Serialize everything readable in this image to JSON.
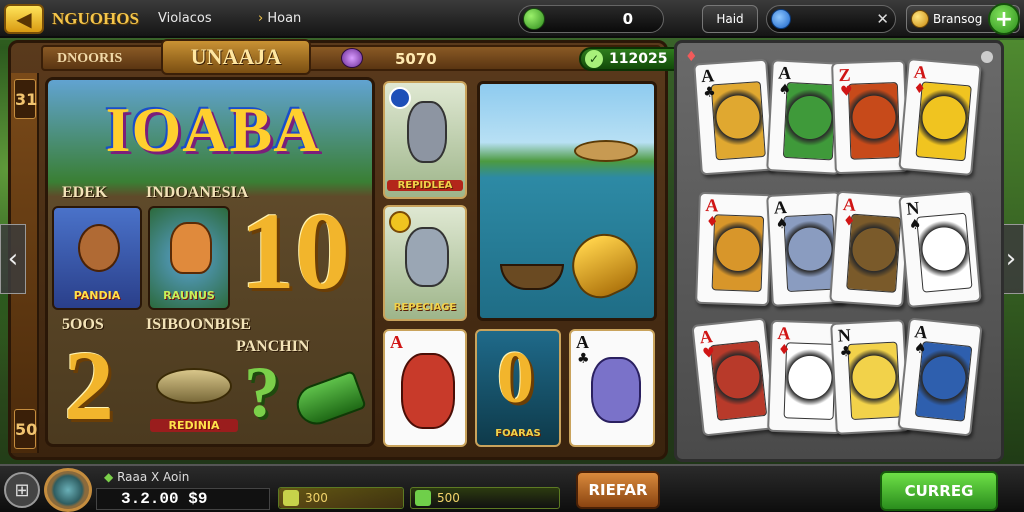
{
  "topbar": {
    "back_glyph": "◀",
    "title": "NGUOHOS",
    "tab_one": "Violacos",
    "tab_two": "Hoan",
    "gems_value": "0",
    "hold_label": "Haid",
    "coins_label": "Bransog"
  },
  "header": {
    "left_label": "DNOORIS",
    "center_title": "UNAAJA",
    "center_value": "5070",
    "score_value": "112025"
  },
  "rails": {
    "top_number": "31",
    "bottom_number": "50"
  },
  "slot": {
    "logo_text": "IOABA",
    "label_top_left": "EDEK",
    "label_top_right": "INDOANESIA",
    "label_mid_left": "5OOS",
    "label_mid_right": "ISIBOONBISE",
    "label_mid_far": "PANCHIN",
    "tile_mouse_caption": "PANDIA",
    "tile_fox_caption": "RAUNUS",
    "tile_fish_caption": "REDINIA",
    "big_digits_one": "10",
    "big_digit_two": "2",
    "big_digit_three": "?"
  },
  "middle": {
    "tile_donkey_caption": "REPIDLEA",
    "tile_shark_caption": "REPECIAGE",
    "tile_fox_card_rank": "A",
    "tile_zero_caption": "FOARAS",
    "tile_zero_digit": "0",
    "tile_ace_rank": "A"
  },
  "cards": [
    {
      "rank": "A",
      "suit": "♣",
      "color": "black",
      "art": "#e0a830"
    },
    {
      "rank": "A",
      "suit": "♠",
      "color": "black",
      "art": "#3f9a3a"
    },
    {
      "rank": "Z",
      "suit": "♥",
      "color": "red",
      "art": "#c74a1a"
    },
    {
      "rank": "A",
      "suit": "♦",
      "color": "red",
      "art": "#f0c420"
    },
    {
      "rank": "A",
      "suit": "♦",
      "color": "red",
      "art": "#d8962a"
    },
    {
      "rank": "A",
      "suit": "♠",
      "color": "black",
      "art": "#8a9cc0"
    },
    {
      "rank": "A",
      "suit": "♦",
      "color": "red",
      "art": "#7a5a2a"
    },
    {
      "rank": "N",
      "suit": "♠",
      "color": "black",
      "art": "#ffffff"
    },
    {
      "rank": "A",
      "suit": "♥",
      "color": "red",
      "art": "#b83a2a"
    },
    {
      "rank": "A",
      "suit": "♦",
      "color": "red",
      "art": "#ffffff"
    },
    {
      "rank": "N",
      "suit": "♣",
      "color": "black",
      "art": "#f2d24a"
    },
    {
      "rank": "A",
      "suit": "♠",
      "color": "black",
      "art": "#2e5fae"
    }
  ],
  "bottombar": {
    "player_name": "Raaa X Aoin",
    "balance": "3.2.00 $9",
    "bet_one": "300",
    "bet_two": "500",
    "refresh_label": "RIEFAR",
    "go_label": "CURREG"
  },
  "colors": {
    "accent_gold": "#f2b52c",
    "accent_green": "#2a8d1d",
    "panel_wood": "#5a3a1c"
  }
}
